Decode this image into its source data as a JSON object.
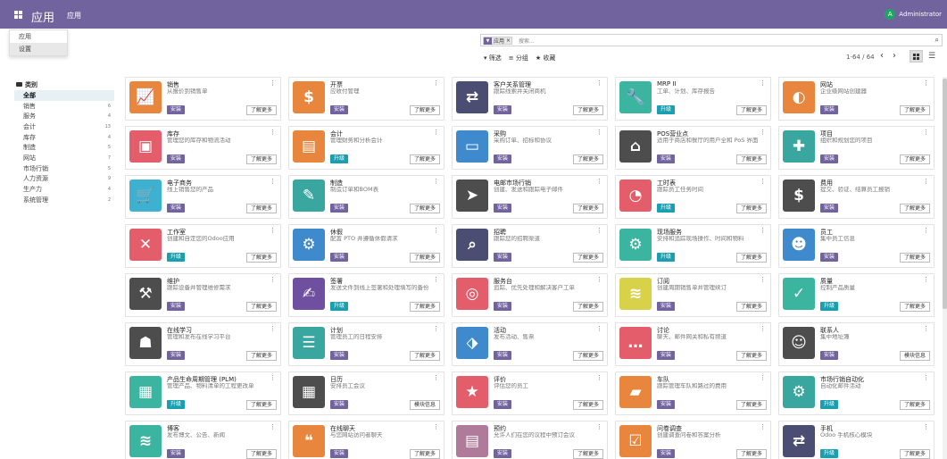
{
  "navbar": {
    "app_title": "应用",
    "menu_label": "应用",
    "user": {
      "initial": "A",
      "name": "Administrator",
      "avatar_color": "#1fa463"
    },
    "brand_color": "#71639e"
  },
  "dropdown": {
    "items": [
      "应用",
      "设置"
    ],
    "hovered": "设置"
  },
  "search": {
    "facet_icon": "filter-icon",
    "facet_label": "应用",
    "facet_remove": "×",
    "placeholder": "搜索..."
  },
  "filters": {
    "filter_label": "▾ 筛选",
    "group_label": "≡ 分组",
    "favorite_label": "★ 收藏"
  },
  "pager": {
    "text": "1-64 / 64",
    "prev": "‹",
    "next": "›"
  },
  "sidebar": {
    "header": "类别",
    "items": [
      {
        "label": "全部",
        "count": ""
      },
      {
        "label": "销售",
        "count": "6"
      },
      {
        "label": "服务",
        "count": "4"
      },
      {
        "label": "会计",
        "count": "13"
      },
      {
        "label": "库存",
        "count": "4"
      },
      {
        "label": "制造",
        "count": "5"
      },
      {
        "label": "网站",
        "count": "7"
      },
      {
        "label": "市场行销",
        "count": "5"
      },
      {
        "label": "人力资源",
        "count": "9"
      },
      {
        "label": "生产力",
        "count": "4"
      },
      {
        "label": "系统管理",
        "count": "2"
      }
    ]
  },
  "apps": [
    {
      "title": "销售",
      "summary": "从报价到销售单",
      "action": "安装",
      "more": "了解更多",
      "icon": "chart-icon",
      "color": "#e9863d"
    },
    {
      "title": "开票",
      "summary": "应收付管理",
      "action": "安装",
      "more": "了解更多",
      "icon": "invoice-icon",
      "color": "#e9863d"
    },
    {
      "title": "客户关系管理",
      "summary": "跟踪线索并关闭商机",
      "action": "安装",
      "more": "了解更多",
      "icon": "handshake-icon",
      "color": "#4c4d73"
    },
    {
      "title": "MRP II",
      "summary": "工单、计划、库存报告",
      "action": "升级",
      "more": "了解更多",
      "icon": "wrench-icon",
      "color": "#3bb4a0"
    },
    {
      "title": "网站",
      "summary": "企业级网站创建器",
      "action": "安装",
      "more": "了解更多",
      "icon": "globe-icon",
      "color": "#e9863d"
    },
    {
      "title": "库存",
      "summary": "管理您的库存和物流活动",
      "action": "安装",
      "more": "了解更多",
      "icon": "box-icon",
      "color": "#e35d6a"
    },
    {
      "title": "会计",
      "summary": "管理财务和分析会计",
      "action": "升级",
      "more": "了解更多",
      "icon": "document-icon",
      "color": "#e9863d"
    },
    {
      "title": "采购",
      "summary": "采购订单、招标和协议",
      "action": "安装",
      "more": "了解更多",
      "icon": "card-icon",
      "color": "#3e8acc"
    },
    {
      "title": "POS营业点",
      "summary": "适用于商店和餐厅的用户全和 PoS 界面",
      "action": "安装",
      "more": "了解更多",
      "icon": "store-icon",
      "color": "#4d4d4d"
    },
    {
      "title": "项目",
      "summary": "组织和规划您的项目",
      "action": "安装",
      "more": "了解更多",
      "icon": "puzzle-icon",
      "color": "#3aa6a0"
    },
    {
      "title": "电子商务",
      "summary": "线上销售您的产品",
      "action": "安装",
      "more": "了解更多",
      "icon": "cart-icon",
      "color": "#3eb0d0"
    },
    {
      "title": "制造",
      "summary": "制造订单和BOM表",
      "action": "安装",
      "more": "了解更多",
      "icon": "tool-icon",
      "color": "#3aa6a0"
    },
    {
      "title": "电邮市场行销",
      "summary": "创建、发送和跟踪电子邮件",
      "action": "安装",
      "more": "了解更多",
      "icon": "paper-plane-icon",
      "color": "#4d4d4d"
    },
    {
      "title": "工时表",
      "summary": "跟踪员工任务时间",
      "action": "升级",
      "more": "了解更多",
      "icon": "stopwatch-icon",
      "color": "#e35d6a"
    },
    {
      "title": "费用",
      "summary": "提交、验证、结算员工报销",
      "action": "安装",
      "more": "了解更多",
      "icon": "expense-icon",
      "color": "#4d4d4d"
    },
    {
      "title": "工作室",
      "summary": "创建和自定您的Odoo应用",
      "action": "升级",
      "more": "了解更多",
      "icon": "tools-icon",
      "color": "#e35d6a"
    },
    {
      "title": "休假",
      "summary": "配置 PTO 并遵循休假请求",
      "action": "安装",
      "more": "了解更多",
      "icon": "people-gear-icon",
      "color": "#3e8acc"
    },
    {
      "title": "招聘",
      "summary": "跟踪您的招聘渠道",
      "action": "安装",
      "more": "了解更多",
      "icon": "magnifier-icon",
      "color": "#4c4d73"
    },
    {
      "title": "现场服务",
      "summary": "安排和追踪现场操作、时间和物料",
      "action": "升级",
      "more": "了解更多",
      "icon": "field-icon",
      "color": "#3bb4a0"
    },
    {
      "title": "员工",
      "summary": "集中员工信息",
      "action": "安装",
      "more": "了解更多",
      "icon": "employees-icon",
      "color": "#3e8acc"
    },
    {
      "title": "维护",
      "summary": "跟踪设备并管理维修需求",
      "action": "安装",
      "more": "了解更多",
      "icon": "hammer-icon",
      "color": "#4d4d4d"
    },
    {
      "title": "签署",
      "summary": "发送文件到线上签署和处理填写的备份",
      "action": "升级",
      "more": "了解更多",
      "icon": "sign-icon",
      "color": "#6f4f9f"
    },
    {
      "title": "服务台",
      "summary": "追踪、优先处理和解决客户工单",
      "action": "安装",
      "more": "了解更多",
      "icon": "lifebuoy-icon",
      "color": "#e35d6a"
    },
    {
      "title": "订阅",
      "summary": "创建周期销售单并管理续订",
      "action": "安装",
      "more": "了解更多",
      "icon": "rss-icon",
      "color": "#d8d24a"
    },
    {
      "title": "质量",
      "summary": "控制产品质量",
      "action": "升级",
      "more": "了解更多",
      "icon": "quality-icon",
      "color": "#3bb4a0"
    },
    {
      "title": "在线学习",
      "summary": "管理和发布在线学习平台",
      "action": "安装",
      "more": "了解更多",
      "icon": "elearning-icon",
      "color": "#4d4d4d"
    },
    {
      "title": "计划",
      "summary": "管理员工的日程安排",
      "action": "安装",
      "more": "了解更多",
      "icon": "planning-icon",
      "color": "#3aa6a0"
    },
    {
      "title": "活动",
      "summary": "发布活动、售票",
      "action": "安装",
      "more": "了解更多",
      "icon": "ticket-icon",
      "color": "#3e8acc"
    },
    {
      "title": "讨论",
      "summary": "聊天、邮件网关和私有频道",
      "action": "安装",
      "more": "了解更多",
      "icon": "chat-icon",
      "color": "#e35d6a"
    },
    {
      "title": "联系人",
      "summary": "集中地址簿",
      "action": "安装",
      "more": "模块信息",
      "icon": "contact-icon",
      "color": "#4d4d4d"
    },
    {
      "title": "产品生命周期管理 (PLM)",
      "summary": "管理产品、物料清单的工程更改单",
      "action": "升级",
      "more": "了解更多",
      "icon": "cube-icon",
      "color": "#3bb4a0"
    },
    {
      "title": "日历",
      "summary": "安排员工会议",
      "action": "安装",
      "more": "模块信息",
      "icon": "calendar-icon",
      "color": "#4d4d4d"
    },
    {
      "title": "评价",
      "summary": "评估您的员工",
      "action": "安装",
      "more": "了解更多",
      "icon": "star-icon",
      "color": "#e35d6a"
    },
    {
      "title": "车队",
      "summary": "跟踪管理车队和路过的费用",
      "action": "安装",
      "more": "了解更多",
      "icon": "car-icon",
      "color": "#e9863d"
    },
    {
      "title": "市场行销自动化",
      "summary": "自动化邮件活动",
      "action": "升级",
      "more": "了解更多",
      "icon": "gear-icon",
      "color": "#3aa6a0"
    },
    {
      "title": "博客",
      "summary": "发布博文、公告、新闻",
      "action": "安装",
      "more": "了解更多",
      "icon": "blog-rss-icon",
      "color": "#3bb4a0"
    },
    {
      "title": "在线聊天",
      "summary": "与您网站访问者聊天",
      "action": "安装",
      "more": "了解更多",
      "icon": "chat-bubbles-icon",
      "color": "#e9863d"
    },
    {
      "title": "预约",
      "summary": "允许人们在您的议程中预订会议",
      "action": "安装",
      "more": "了解更多",
      "icon": "appointment-icon",
      "color": "#b07a9a"
    },
    {
      "title": "问卷调查",
      "summary": "创建调查问卷和答案分析",
      "action": "安装",
      "more": "了解更多",
      "icon": "survey-icon",
      "color": "#e9863d"
    },
    {
      "title": "手机",
      "summary": "Odoo 手机核心模块",
      "action": "升级",
      "more": "了解更多",
      "icon": "mobile-handshake-icon",
      "color": "#4c4d73"
    }
  ]
}
